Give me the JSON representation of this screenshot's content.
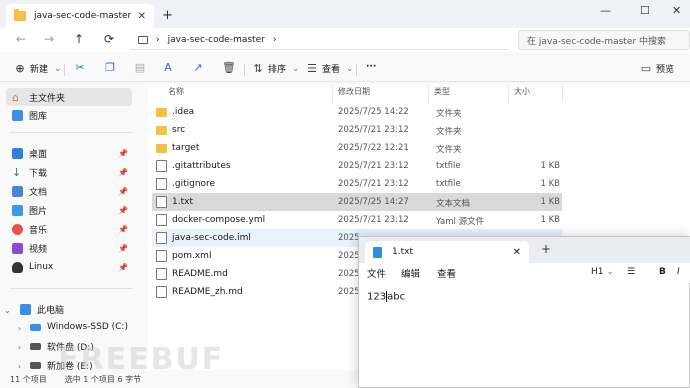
{
  "explorer": {
    "tab_title": "java-sec-code-master",
    "new_tab": "+",
    "win_minimize": "—",
    "win_maximize": "☐",
    "win_close": "✕",
    "nav_back": "←",
    "nav_forward": "→",
    "nav_up": "↑",
    "nav_refresh": "⟳",
    "address_sep1": "›",
    "address_folder": "java-sec-code-master",
    "address_sep2": "›",
    "search_placeholder": "在 java-sec-code-master 中搜索",
    "toolbar": {
      "new_label": "新建",
      "sort_label": "排序",
      "view_label": "查看",
      "more_label": "···",
      "preview_label": "预览"
    }
  },
  "sidebar": {
    "home": "主文件夹",
    "gallery": "图库",
    "items": [
      {
        "label": "桌面"
      },
      {
        "label": "下载"
      },
      {
        "label": "文档"
      },
      {
        "label": "图片"
      },
      {
        "label": "音乐"
      },
      {
        "label": "视频"
      },
      {
        "label": "Linux"
      }
    ],
    "this_pc": "此电脑",
    "drives": [
      {
        "label": "Windows-SSD (C:)"
      },
      {
        "label": "软件盘 (D:)"
      },
      {
        "label": "新加卷 (E:)"
      }
    ]
  },
  "filelist": {
    "headers": {
      "name": "名称",
      "date": "修改日期",
      "type": "类型",
      "size": "大小"
    },
    "rows": [
      {
        "name": ".idea",
        "date": "2025/7/25 14:22",
        "type": "文件夹",
        "size": "",
        "kind": "folder"
      },
      {
        "name": "src",
        "date": "2025/7/21 23:12",
        "type": "文件夹",
        "size": "",
        "kind": "folder"
      },
      {
        "name": "target",
        "date": "2025/7/22 12:21",
        "type": "文件夹",
        "size": "",
        "kind": "folder"
      },
      {
        "name": ".gitattributes",
        "date": "2025/7/21 23:12",
        "type": "txtfile",
        "size": "1 KB",
        "kind": "file"
      },
      {
        "name": ".gitignore",
        "date": "2025/7/21 23:12",
        "type": "txtfile",
        "size": "1 KB",
        "kind": "file"
      },
      {
        "name": "1.txt",
        "date": "2025/7/25 14:27",
        "type": "文本文档",
        "size": "1 KB",
        "kind": "file"
      },
      {
        "name": "docker-compose.yml",
        "date": "2025/7/21 23:12",
        "type": "Yaml 源文件",
        "size": "1 KB",
        "kind": "file"
      },
      {
        "name": "java-sec-code.iml",
        "date": "2025",
        "type": "",
        "size": "",
        "kind": "file"
      },
      {
        "name": "pom.xml",
        "date": "2025",
        "type": "",
        "size": "",
        "kind": "file"
      },
      {
        "name": "README.md",
        "date": "2025",
        "type": "",
        "size": "",
        "kind": "file"
      },
      {
        "name": "README_zh.md",
        "date": "2025",
        "type": "",
        "size": "",
        "kind": "file"
      }
    ]
  },
  "status": {
    "count": "11 个项目",
    "selected": "选中 1 个项目  6 字节"
  },
  "watermark": "FREEBUF",
  "notepad": {
    "tab_title": "1.txt",
    "close": "✕",
    "plus": "+",
    "menu": {
      "file": "文件",
      "edit": "编辑",
      "view": "查看"
    },
    "heading": "H1",
    "bold": "B",
    "content_before": "123",
    "content_after": "abc"
  }
}
